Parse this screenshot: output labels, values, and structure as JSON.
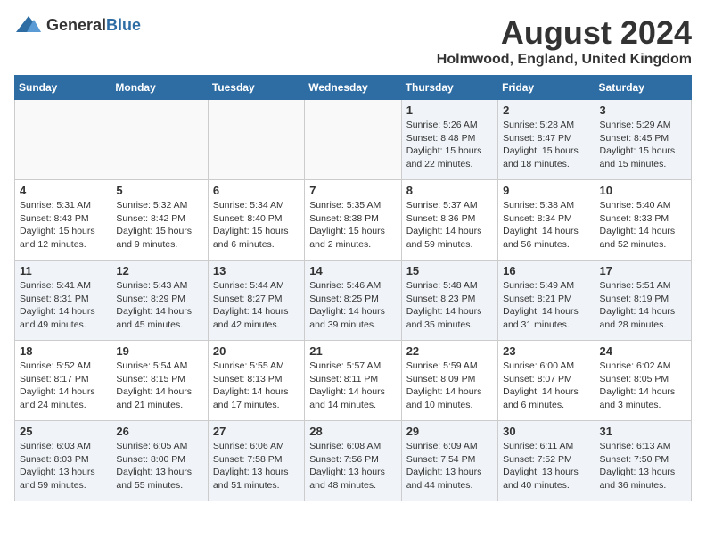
{
  "logo": {
    "general": "General",
    "blue": "Blue"
  },
  "title": "August 2024",
  "subtitle": "Holmwood, England, United Kingdom",
  "days_of_week": [
    "Sunday",
    "Monday",
    "Tuesday",
    "Wednesday",
    "Thursday",
    "Friday",
    "Saturday"
  ],
  "weeks": [
    [
      {
        "day": "",
        "info": ""
      },
      {
        "day": "",
        "info": ""
      },
      {
        "day": "",
        "info": ""
      },
      {
        "day": "",
        "info": ""
      },
      {
        "day": "1",
        "info": "Sunrise: 5:26 AM\nSunset: 8:48 PM\nDaylight: 15 hours\nand 22 minutes."
      },
      {
        "day": "2",
        "info": "Sunrise: 5:28 AM\nSunset: 8:47 PM\nDaylight: 15 hours\nand 18 minutes."
      },
      {
        "day": "3",
        "info": "Sunrise: 5:29 AM\nSunset: 8:45 PM\nDaylight: 15 hours\nand 15 minutes."
      }
    ],
    [
      {
        "day": "4",
        "info": "Sunrise: 5:31 AM\nSunset: 8:43 PM\nDaylight: 15 hours\nand 12 minutes."
      },
      {
        "day": "5",
        "info": "Sunrise: 5:32 AM\nSunset: 8:42 PM\nDaylight: 15 hours\nand 9 minutes."
      },
      {
        "day": "6",
        "info": "Sunrise: 5:34 AM\nSunset: 8:40 PM\nDaylight: 15 hours\nand 6 minutes."
      },
      {
        "day": "7",
        "info": "Sunrise: 5:35 AM\nSunset: 8:38 PM\nDaylight: 15 hours\nand 2 minutes."
      },
      {
        "day": "8",
        "info": "Sunrise: 5:37 AM\nSunset: 8:36 PM\nDaylight: 14 hours\nand 59 minutes."
      },
      {
        "day": "9",
        "info": "Sunrise: 5:38 AM\nSunset: 8:34 PM\nDaylight: 14 hours\nand 56 minutes."
      },
      {
        "day": "10",
        "info": "Sunrise: 5:40 AM\nSunset: 8:33 PM\nDaylight: 14 hours\nand 52 minutes."
      }
    ],
    [
      {
        "day": "11",
        "info": "Sunrise: 5:41 AM\nSunset: 8:31 PM\nDaylight: 14 hours\nand 49 minutes."
      },
      {
        "day": "12",
        "info": "Sunrise: 5:43 AM\nSunset: 8:29 PM\nDaylight: 14 hours\nand 45 minutes."
      },
      {
        "day": "13",
        "info": "Sunrise: 5:44 AM\nSunset: 8:27 PM\nDaylight: 14 hours\nand 42 minutes."
      },
      {
        "day": "14",
        "info": "Sunrise: 5:46 AM\nSunset: 8:25 PM\nDaylight: 14 hours\nand 39 minutes."
      },
      {
        "day": "15",
        "info": "Sunrise: 5:48 AM\nSunset: 8:23 PM\nDaylight: 14 hours\nand 35 minutes."
      },
      {
        "day": "16",
        "info": "Sunrise: 5:49 AM\nSunset: 8:21 PM\nDaylight: 14 hours\nand 31 minutes."
      },
      {
        "day": "17",
        "info": "Sunrise: 5:51 AM\nSunset: 8:19 PM\nDaylight: 14 hours\nand 28 minutes."
      }
    ],
    [
      {
        "day": "18",
        "info": "Sunrise: 5:52 AM\nSunset: 8:17 PM\nDaylight: 14 hours\nand 24 minutes."
      },
      {
        "day": "19",
        "info": "Sunrise: 5:54 AM\nSunset: 8:15 PM\nDaylight: 14 hours\nand 21 minutes."
      },
      {
        "day": "20",
        "info": "Sunrise: 5:55 AM\nSunset: 8:13 PM\nDaylight: 14 hours\nand 17 minutes."
      },
      {
        "day": "21",
        "info": "Sunrise: 5:57 AM\nSunset: 8:11 PM\nDaylight: 14 hours\nand 14 minutes."
      },
      {
        "day": "22",
        "info": "Sunrise: 5:59 AM\nSunset: 8:09 PM\nDaylight: 14 hours\nand 10 minutes."
      },
      {
        "day": "23",
        "info": "Sunrise: 6:00 AM\nSunset: 8:07 PM\nDaylight: 14 hours\nand 6 minutes."
      },
      {
        "day": "24",
        "info": "Sunrise: 6:02 AM\nSunset: 8:05 PM\nDaylight: 14 hours\nand 3 minutes."
      }
    ],
    [
      {
        "day": "25",
        "info": "Sunrise: 6:03 AM\nSunset: 8:03 PM\nDaylight: 13 hours\nand 59 minutes."
      },
      {
        "day": "26",
        "info": "Sunrise: 6:05 AM\nSunset: 8:00 PM\nDaylight: 13 hours\nand 55 minutes."
      },
      {
        "day": "27",
        "info": "Sunrise: 6:06 AM\nSunset: 7:58 PM\nDaylight: 13 hours\nand 51 minutes."
      },
      {
        "day": "28",
        "info": "Sunrise: 6:08 AM\nSunset: 7:56 PM\nDaylight: 13 hours\nand 48 minutes."
      },
      {
        "day": "29",
        "info": "Sunrise: 6:09 AM\nSunset: 7:54 PM\nDaylight: 13 hours\nand 44 minutes."
      },
      {
        "day": "30",
        "info": "Sunrise: 6:11 AM\nSunset: 7:52 PM\nDaylight: 13 hours\nand 40 minutes."
      },
      {
        "day": "31",
        "info": "Sunrise: 6:13 AM\nSunset: 7:50 PM\nDaylight: 13 hours\nand 36 minutes."
      }
    ]
  ]
}
